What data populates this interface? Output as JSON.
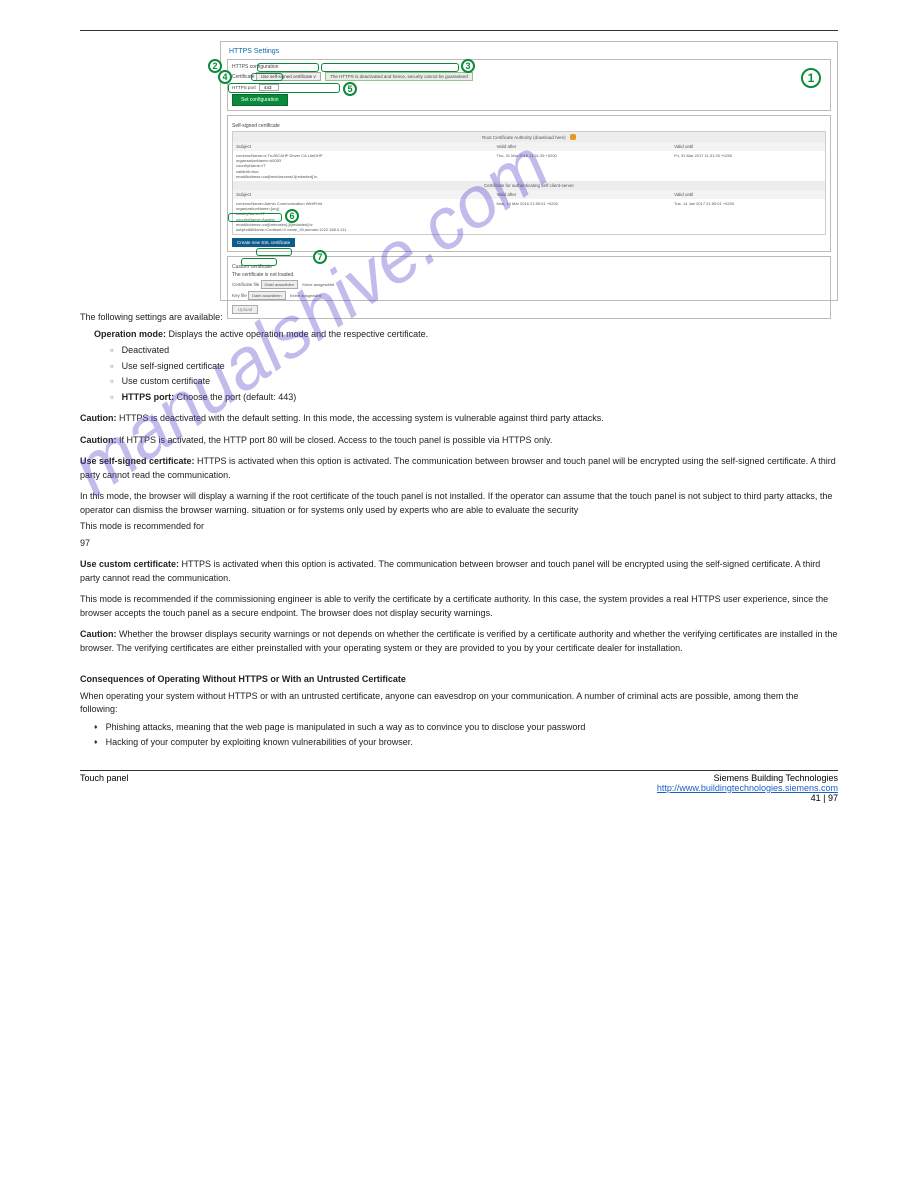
{
  "screenshot": {
    "title": "HTTPS Settings",
    "config_box_title": "HTTPS configuration",
    "cert_field_label": "Certificate",
    "cert_button": "Use self-signed certificate v",
    "cert_hint": "The HTTPS is deactivated and hence, security cannot be guaranteed",
    "port_label": "HTTPS port",
    "port_value": "443",
    "set_config_button": "Set configuration",
    "self_signed_title": "Self-signed certificate",
    "download_hint": "Root Certificate Authority (download here)",
    "table_headers": {
      "subject": "Subject",
      "valid_after": "Valid after",
      "valid_until": "Valid until"
    },
    "cert1": {
      "subject": "commonName=e.TruStCAHP Driver CA LiteDHP\norganzationName=#0053\ncountryName=IT\nvalidntil=true\nemailAddress=ca@mobiaccessI.t[redacted].tc",
      "after": "Thu, 31 Mar 2016 11:31:25 +0200",
      "until": "Fri, 31 Mar 2017 11:31:25 +0200"
    },
    "middle_banner": "Certificate for authenticating self client-server",
    "cert2": {
      "subject": "commonName=Admin Communication WebPrint\norganizationName=[org]\nlocalityName=IT\ncountryName=Austria\nemailAddress=ca@releases[-]t[redacted].tc\nsubjectAltName=Cert#set=0 name_30,domain:1222.168.0.111",
      "after": "Mon, 14 Mar 2016 21:50:01 +0200",
      "until": "Tue, 14 Jan 2017 21:50:01 +0200"
    },
    "new_ssl_button": "Create new SSL certificate",
    "custom_title": "Custom certificate",
    "custom_note": "The certificate is not loaded.",
    "file_label_cert": "Certificate file",
    "file_label_key": "Key file",
    "choose": "Datei auswählen",
    "nosel": "Keine ausgewählt",
    "upload": "Upload"
  },
  "callouts": {
    "c1": "1",
    "c2": "2",
    "c3": "3",
    "c4": "4",
    "c5": "5",
    "c6": "6",
    "c7": "7"
  },
  "para": {
    "p0": "The following settings are available:",
    "b1_lead": "Operation mode:",
    "b1_body": " Displays the active operation mode and the respective certificate.",
    "b2": "Deactivated",
    "b3": "Use self-signed certificate",
    "b4": "Use custom certificate",
    "b5_lead": "HTTPS port:",
    "b5_body": " Choose the port (default: 443)",
    "p3_lead": "Caution:",
    "p3_body": " HTTPS is deactivated with the default setting. In this mode, the accessing system is vulnerable against third party attacks.",
    "p4_lead": "Caution:",
    "p4_body": " If HTTPS is activated, the HTTP port 80 will be closed. Access to the touch panel is possible via HTTPS only.",
    "p5_lead": "Use self-signed certificate:",
    "p5_body": " HTTPS is activated when this option is activated. The communication between browser and touch panel will be encrypted using the self-signed certificate. A third party cannot read the communication.",
    "p6": "97",
    "p7_lead": "Use custom certificate:",
    "p7_body": " HTTPS is activated when this option is activated. The communication between browser and touch panel will be encrypted using the self-signed certificate. A third party cannot read the communication.",
    "p8": "This mode is recommended if the commissioning engineer is able to verify the certificate by a certificate authority. In this case, the system provides a real HTTPS user experience, since the browser accepts the touch panel as a secure endpoint. The browser does not display security warnings.",
    "p9_lead": "Caution:",
    "p9_body": " Whether the browser displays security warnings or not depends on whether the certificate is verified by a certificate authority and whether the verifying certificates are installed in the browser. The verifying certificates are either preinstalled with your operating system or they are provided to you by your certificate dealer for installation.",
    "end_lead": "Consequences of Operating Without HTTPS or With an Untrusted Certificate",
    "end_body": "When operating your system without HTTPS or with an untrusted certificate, anyone can eavesdrop on your communication. A number of criminal acts are possible, among them the following:",
    "eb1": "Phishing attacks, meaning that the web page is manipulated in such a way as to convince you to disclose your password",
    "eb2": "Hacking of your computer by exploiting known vulnerabilities of your browser."
  },
  "note_self_signed": "In this mode, the browser will display a warning if the root certificate of the touch panel is not installed. If the operator can assume that the touch panel is not subject to third party attacks, the operator can dismiss the browser warning.                                situation or for systems only used by experts who are able to evaluate the security",
  "note_self_signed2": "This mode is recommended for",
  "footer": {
    "left": "Touch panel",
    "right_line1": "Siemens Building Technologies",
    "right_line2": "http://www.buildingtechnologies.siemens.com",
    "pagenum": "41 | 97"
  },
  "watermark": "manualshive.com"
}
